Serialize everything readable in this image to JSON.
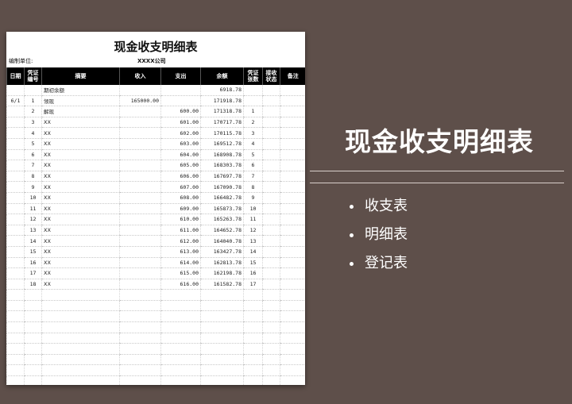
{
  "sheet": {
    "title": "现金收支明细表",
    "unit_label": "编制单位:",
    "company": "XXXX公司",
    "headers": {
      "date": "日期",
      "voucher": [
        "凭证",
        "编号"
      ],
      "summary": "摘要",
      "income": "收入",
      "expense": "支出",
      "balance": "余额",
      "count": [
        "凭证",
        "张数"
      ],
      "status": [
        "接收",
        "状态"
      ],
      "note": "备注"
    },
    "rows": [
      {
        "date": "",
        "no": "",
        "summary": "期初余额",
        "income": "",
        "expense": "",
        "balance": "6918.78",
        "count": "",
        "status": "",
        "note": ""
      },
      {
        "date": "6/1",
        "no": "1",
        "summary": "领现",
        "income": "165000.00",
        "expense": "",
        "balance": "171918.78",
        "count": "",
        "status": "",
        "note": ""
      },
      {
        "date": "",
        "no": "2",
        "summary": "解现",
        "income": "",
        "expense": "600.00",
        "balance": "171318.78",
        "count": "1",
        "status": "",
        "note": ""
      },
      {
        "date": "",
        "no": "3",
        "summary": "XX",
        "income": "",
        "expense": "601.00",
        "balance": "170717.78",
        "count": "2",
        "status": "",
        "note": ""
      },
      {
        "date": "",
        "no": "4",
        "summary": "XX",
        "income": "",
        "expense": "602.00",
        "balance": "170115.78",
        "count": "3",
        "status": "",
        "note": ""
      },
      {
        "date": "",
        "no": "5",
        "summary": "XX",
        "income": "",
        "expense": "603.00",
        "balance": "169512.78",
        "count": "4",
        "status": "",
        "note": ""
      },
      {
        "date": "",
        "no": "6",
        "summary": "XX",
        "income": "",
        "expense": "604.00",
        "balance": "168908.78",
        "count": "5",
        "status": "",
        "note": ""
      },
      {
        "date": "",
        "no": "7",
        "summary": "XX",
        "income": "",
        "expense": "605.00",
        "balance": "168303.78",
        "count": "6",
        "status": "",
        "note": ""
      },
      {
        "date": "",
        "no": "8",
        "summary": "XX",
        "income": "",
        "expense": "606.00",
        "balance": "167697.78",
        "count": "7",
        "status": "",
        "note": ""
      },
      {
        "date": "",
        "no": "9",
        "summary": "XX",
        "income": "",
        "expense": "607.00",
        "balance": "167090.78",
        "count": "8",
        "status": "",
        "note": ""
      },
      {
        "date": "",
        "no": "10",
        "summary": "XX",
        "income": "",
        "expense": "608.00",
        "balance": "166482.78",
        "count": "9",
        "status": "",
        "note": ""
      },
      {
        "date": "",
        "no": "11",
        "summary": "XX",
        "income": "",
        "expense": "609.00",
        "balance": "165873.78",
        "count": "10",
        "status": "",
        "note": ""
      },
      {
        "date": "",
        "no": "12",
        "summary": "XX",
        "income": "",
        "expense": "610.00",
        "balance": "165263.78",
        "count": "11",
        "status": "",
        "note": ""
      },
      {
        "date": "",
        "no": "13",
        "summary": "XX",
        "income": "",
        "expense": "611.00",
        "balance": "164652.78",
        "count": "12",
        "status": "",
        "note": ""
      },
      {
        "date": "",
        "no": "14",
        "summary": "XX",
        "income": "",
        "expense": "612.00",
        "balance": "164040.78",
        "count": "13",
        "status": "",
        "note": ""
      },
      {
        "date": "",
        "no": "15",
        "summary": "XX",
        "income": "",
        "expense": "613.00",
        "balance": "163427.78",
        "count": "14",
        "status": "",
        "note": ""
      },
      {
        "date": "",
        "no": "16",
        "summary": "XX",
        "income": "",
        "expense": "614.00",
        "balance": "162813.78",
        "count": "15",
        "status": "",
        "note": ""
      },
      {
        "date": "",
        "no": "17",
        "summary": "XX",
        "income": "",
        "expense": "615.00",
        "balance": "162198.78",
        "count": "16",
        "status": "",
        "note": ""
      },
      {
        "date": "",
        "no": "18",
        "summary": "XX",
        "income": "",
        "expense": "616.00",
        "balance": "161582.78",
        "count": "17",
        "status": "",
        "note": ""
      }
    ]
  },
  "side": {
    "title": "现金收支明细表",
    "bullets": [
      "收支表",
      "明细表",
      "登记表"
    ]
  }
}
